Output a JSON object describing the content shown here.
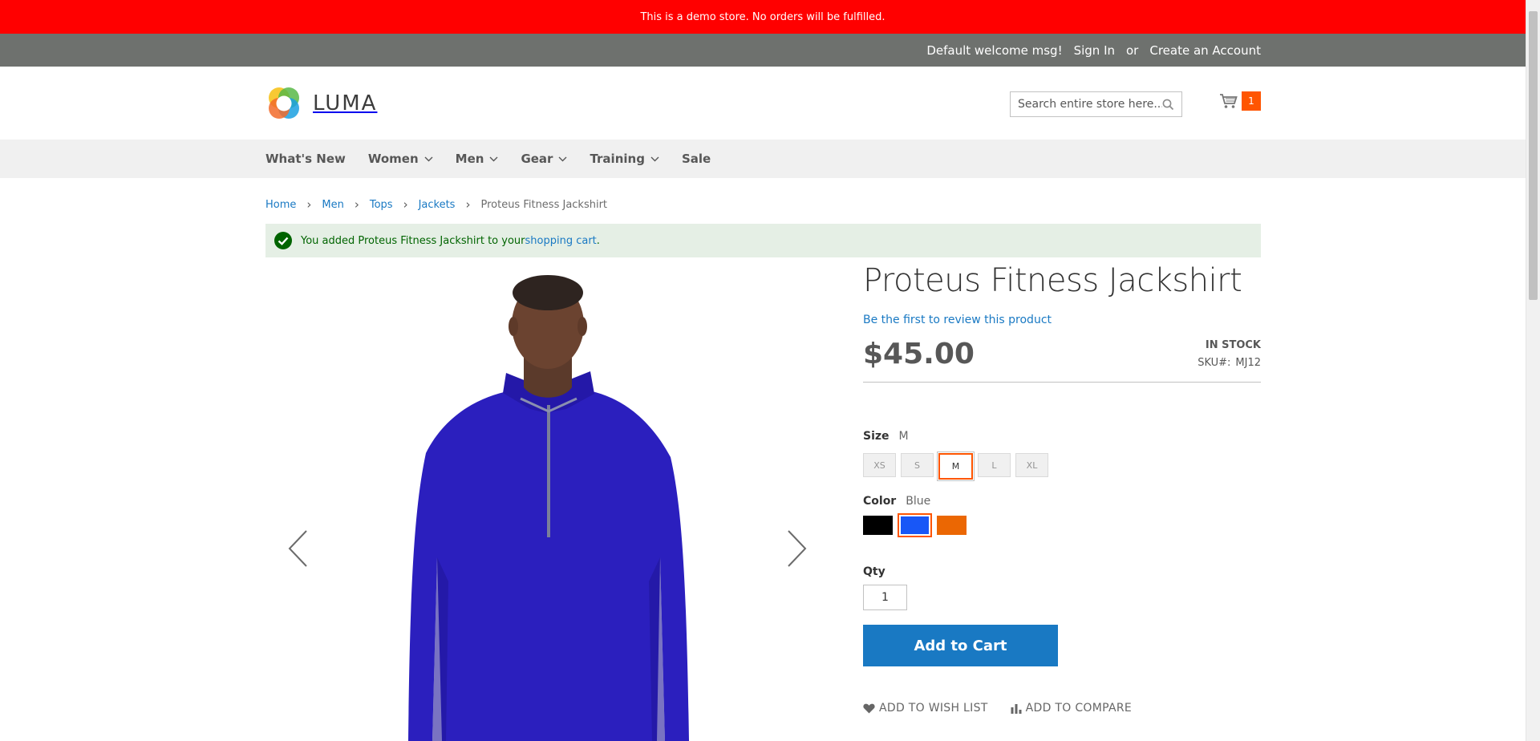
{
  "demo_notice": "This is a demo store. No orders will be fulfilled.",
  "header_panel": {
    "welcome": "Default welcome msg!",
    "sign_in": "Sign In",
    "or": "or",
    "create_account": "Create an Account"
  },
  "logo": {
    "text": "LUMA"
  },
  "search": {
    "placeholder": "Search entire store here..."
  },
  "minicart": {
    "count": "1"
  },
  "nav": {
    "items": [
      {
        "label": "What's New",
        "has_dropdown": false
      },
      {
        "label": "Women",
        "has_dropdown": true
      },
      {
        "label": "Men",
        "has_dropdown": true
      },
      {
        "label": "Gear",
        "has_dropdown": true
      },
      {
        "label": "Training",
        "has_dropdown": true
      },
      {
        "label": "Sale",
        "has_dropdown": false
      }
    ]
  },
  "breadcrumbs": {
    "items": [
      "Home",
      "Men",
      "Tops",
      "Jackets"
    ],
    "current": "Proteus Fitness Jackshirt"
  },
  "message": {
    "text_before": "You added Proteus Fitness Jackshirt to your ",
    "link": "shopping cart",
    "text_after": "."
  },
  "product": {
    "title": "Proteus Fitness Jackshirt",
    "review_link": "Be the first to review this product",
    "price": "$45.00",
    "stock": "In stock",
    "sku_label": "SKU#:",
    "sku": "MJ12",
    "size_label": "Size",
    "size_selected": "M",
    "sizes": [
      "XS",
      "S",
      "M",
      "L",
      "XL"
    ],
    "color_label": "Color",
    "color_selected": "Blue",
    "colors": [
      {
        "name": "Black",
        "hex": "#000000"
      },
      {
        "name": "Blue",
        "hex": "#1857f7"
      },
      {
        "name": "Orange",
        "hex": "#eb6703"
      }
    ],
    "qty_label": "Qty",
    "qty": "1",
    "add_to_cart": "Add to Cart",
    "wishlist": "Add to Wish List",
    "compare": "Add to Compare"
  },
  "colors": {
    "demo_bar": "#ff0000",
    "panel": "#6e716e",
    "accent": "#ff5501",
    "link": "#1979c3",
    "shirt": "#2b1fbe"
  }
}
